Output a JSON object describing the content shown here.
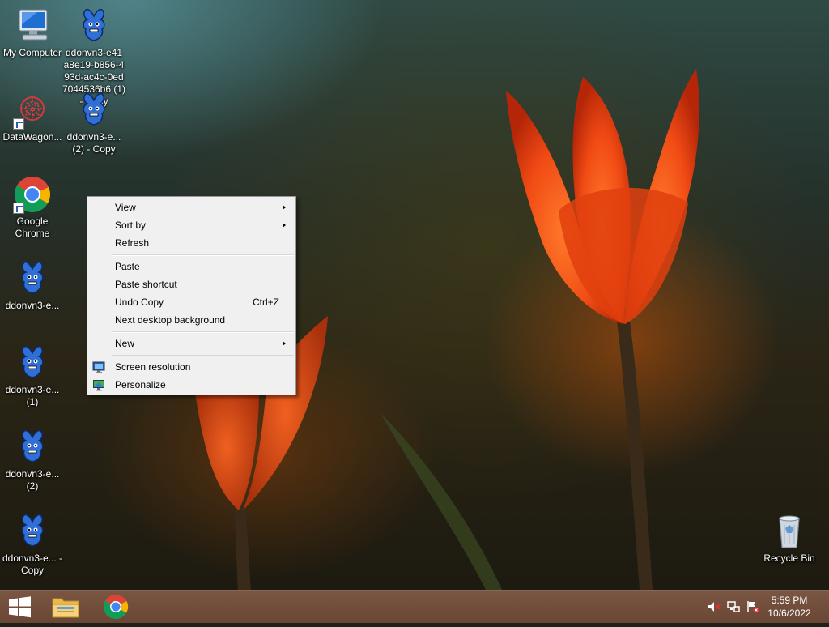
{
  "desktop_icons": [
    {
      "id": "my-computer",
      "label": "My Computer",
      "icon": "computer-icon"
    },
    {
      "id": "ddonvn3-long",
      "label": "ddonvn3-e41 a8e19-b856-4 93d-ac4c-0ed 7044536b6 (1) - Copy",
      "icon": "blue-character-icon"
    },
    {
      "id": "datawagon",
      "label": "DataWagon...",
      "icon": "datawagon-icon"
    },
    {
      "id": "ddonvn3-2-copy",
      "label": "ddonvn3-e... (2) - Copy",
      "icon": "blue-character-icon"
    },
    {
      "id": "google-chrome",
      "label": "Google Chrome",
      "icon": "chrome-icon"
    },
    {
      "id": "ddonvn3-a",
      "label": "ddonvn3-e...",
      "icon": "blue-character-icon"
    },
    {
      "id": "ddonvn3-1",
      "label": "ddonvn3-e... (1)",
      "icon": "blue-character-icon"
    },
    {
      "id": "ddonvn3-2",
      "label": "ddonvn3-e... (2)",
      "icon": "blue-character-icon"
    },
    {
      "id": "ddonvn3-copy",
      "label": "ddonvn3-e... - Copy",
      "icon": "blue-character-icon"
    },
    {
      "id": "recycle-bin",
      "label": "Recycle Bin",
      "icon": "recycle-bin-icon"
    }
  ],
  "context_menu": {
    "items": [
      {
        "label": "View",
        "submenu": true
      },
      {
        "label": "Sort by",
        "submenu": true
      },
      {
        "label": "Refresh"
      },
      {
        "label": "Paste"
      },
      {
        "label": "Paste shortcut"
      },
      {
        "label": "Undo Copy",
        "shortcut": "Ctrl+Z"
      },
      {
        "label": "Next desktop background"
      },
      {
        "label": "New",
        "submenu": true
      },
      {
        "label": "Screen resolution",
        "icon": "monitor-icon"
      },
      {
        "label": "Personalize",
        "icon": "personalize-icon"
      }
    ]
  },
  "taskbar": {
    "buttons": [
      {
        "name": "start-button",
        "icon": "windows-logo-icon"
      },
      {
        "name": "file-explorer-button",
        "icon": "folder-icon"
      },
      {
        "name": "chrome-taskbar-button",
        "icon": "chrome-icon"
      }
    ],
    "tray": [
      {
        "name": "volume-muted-icon"
      },
      {
        "name": "network-icon"
      },
      {
        "name": "action-center-flag-icon"
      }
    ],
    "clock": {
      "time": "5:59 PM",
      "date": "10/6/2022"
    }
  },
  "colors": {
    "taskbar": "#7a5040",
    "menu_bg": "#f0f0f0",
    "flower": "#ff5a1a",
    "character_blue": "#2f6fd6"
  }
}
